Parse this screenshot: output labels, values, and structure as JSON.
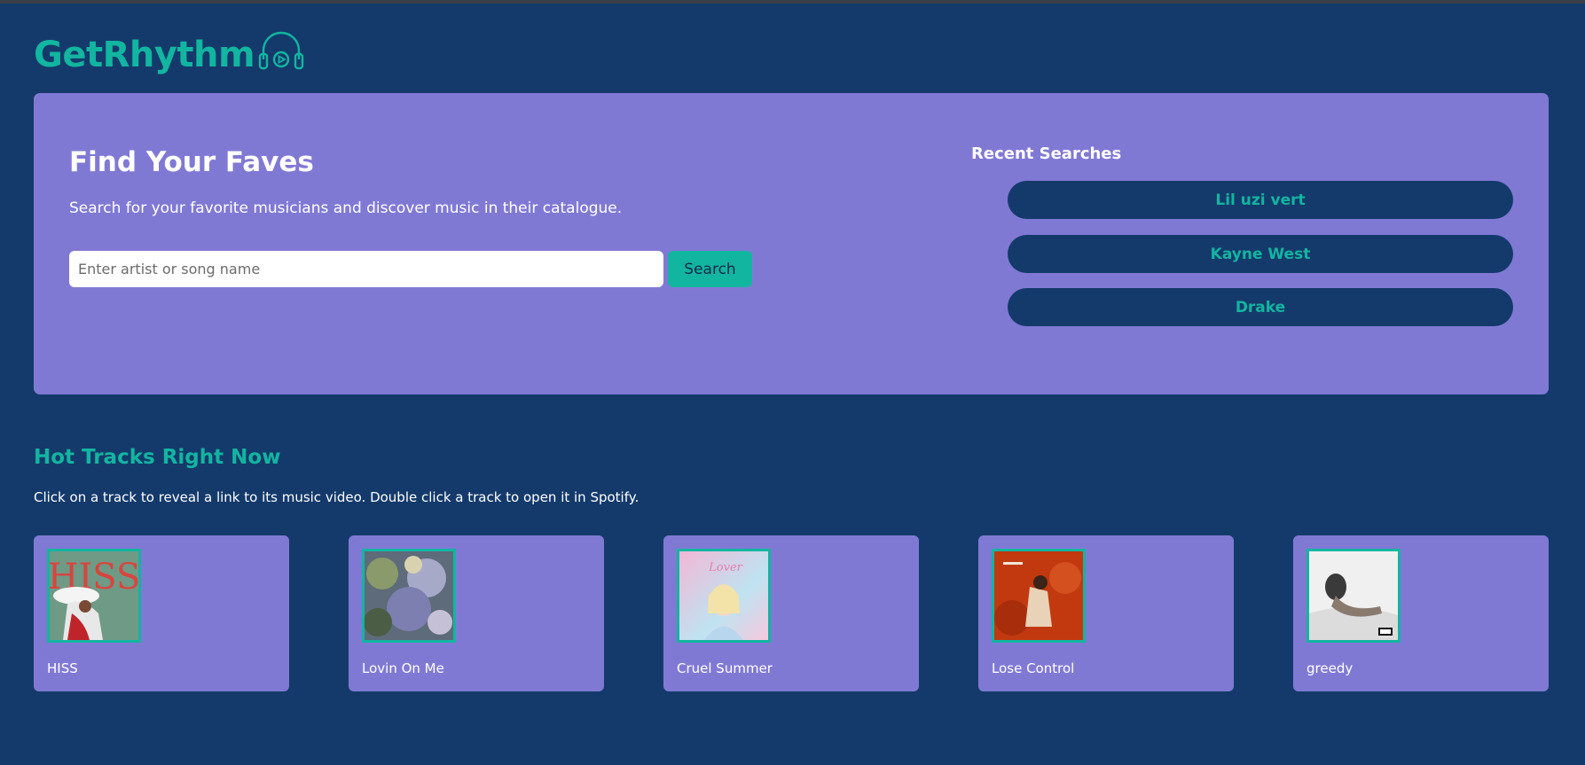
{
  "brand": {
    "name": "GetRhythm",
    "accent_color": "#12b5a0",
    "background_color": "#143a6b",
    "panel_color": "#8079d4",
    "logo_icon": "headphones-play-icon"
  },
  "search_section": {
    "title": "Find Your Faves",
    "subtitle": "Search for your favorite musicians and discover music in their catalogue.",
    "input_placeholder": "Enter artist or song name",
    "input_value": "",
    "button_label": "Search"
  },
  "recent_searches": {
    "title": "Recent Searches",
    "items": [
      "Lil uzi vert",
      "Kayne West",
      "Drake"
    ]
  },
  "hot_tracks": {
    "title": "Hot Tracks Right Now",
    "subtitle": "Click on a track to reveal a link to its music video. Double click a track to open it in Spotify.",
    "tracks": [
      {
        "name": "HISS",
        "cover_text": "HISS"
      },
      {
        "name": "Lovin On Me",
        "cover_text": ""
      },
      {
        "name": "Cruel Summer",
        "cover_text": "Lover"
      },
      {
        "name": "Lose Control",
        "cover_text": ""
      },
      {
        "name": "greedy",
        "cover_text": ""
      }
    ]
  }
}
